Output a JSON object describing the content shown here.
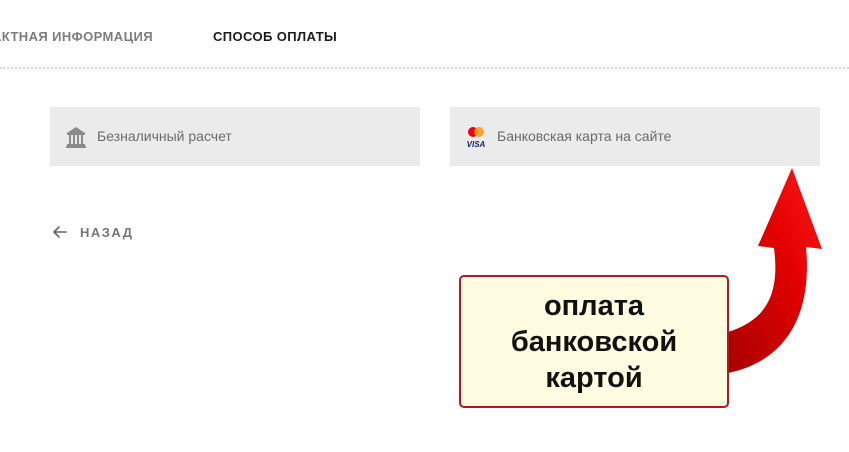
{
  "tabs": {
    "contact_label": "АКТНАЯ ИНФОРМАЦИЯ",
    "payment_label": "СПОСОБ ОПЛАТЫ",
    "active": "payment"
  },
  "payment_methods": [
    {
      "label": "Безналичный расчет",
      "icon": "bank-icon"
    },
    {
      "label": "Банковская карта на сайте",
      "icon": "mastercard-visa-icon"
    }
  ],
  "back": {
    "label": "НАЗАД",
    "icon": "arrow-left-icon"
  },
  "annotation": {
    "text": "оплата\nбанковской\nкартой",
    "icon": "curved-red-arrow-icon"
  },
  "colors": {
    "option_background": "#ebebeb",
    "callout_background": "#fefde2",
    "callout_border": "#b0191e",
    "arrow_red": "#e30000"
  }
}
